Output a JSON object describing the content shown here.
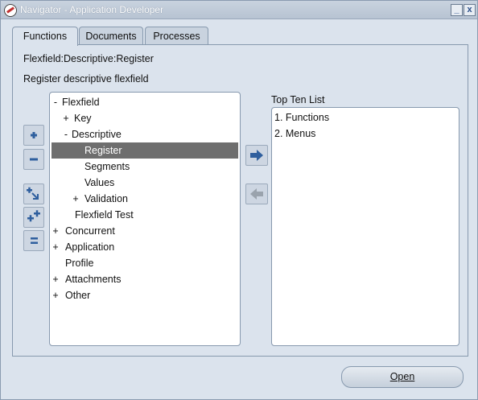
{
  "window": {
    "title": "Navigator - Application Developer",
    "minimize_label": "_",
    "close_label": "x"
  },
  "tabs": [
    {
      "label": "Functions",
      "active": true
    },
    {
      "label": "Documents",
      "active": false
    },
    {
      "label": "Processes",
      "active": false
    }
  ],
  "function_path": "Flexfield:Descriptive:Register",
  "function_description": "Register descriptive flexfield",
  "tree": {
    "items": [
      {
        "expander": "-",
        "label": "Flexfield"
      },
      {
        "expander": "+",
        "label": "Key"
      },
      {
        "expander": "-",
        "label": "Descriptive"
      },
      {
        "expander": "",
        "label": "Register",
        "selected": true
      },
      {
        "expander": "",
        "label": "Segments"
      },
      {
        "expander": "",
        "label": "Values"
      },
      {
        "expander": "+",
        "label": "Validation"
      },
      {
        "expander": "",
        "label": "Flexfield Test"
      },
      {
        "expander": "+",
        "label": "Concurrent"
      },
      {
        "expander": "+",
        "label": "Application"
      },
      {
        "expander": "",
        "label": "Profile"
      },
      {
        "expander": "+",
        "label": "Attachments"
      },
      {
        "expander": "+",
        "label": "Other"
      }
    ]
  },
  "top_ten": {
    "label": "Top Ten List",
    "items": [
      "1. Functions",
      "2. Menus"
    ]
  },
  "buttons": {
    "open": "Open"
  },
  "colors": {
    "accent": "#2f5f9e",
    "selected_row": "#6e6e6e",
    "panel_bg": "#dbe3ed"
  }
}
